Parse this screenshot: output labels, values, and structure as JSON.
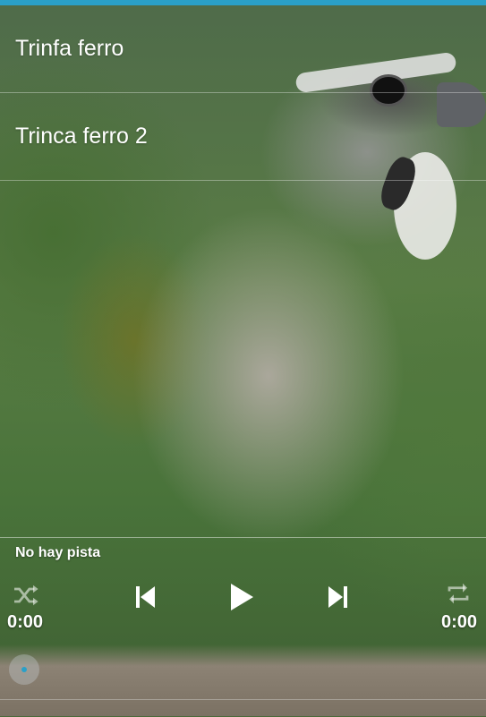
{
  "tracks": [
    {
      "title": "Trinfa ferro"
    },
    {
      "title": "Trinca ferro 2"
    }
  ],
  "player": {
    "now_playing": "No hay pista",
    "elapsed": "0:00",
    "duration": "0:00",
    "icons": {
      "shuffle": "shuffle-icon",
      "previous": "skip-previous-icon",
      "play": "play-icon",
      "next": "skip-next-icon",
      "repeat": "repeat-icon"
    },
    "accent_color": "#2aa0c8"
  }
}
